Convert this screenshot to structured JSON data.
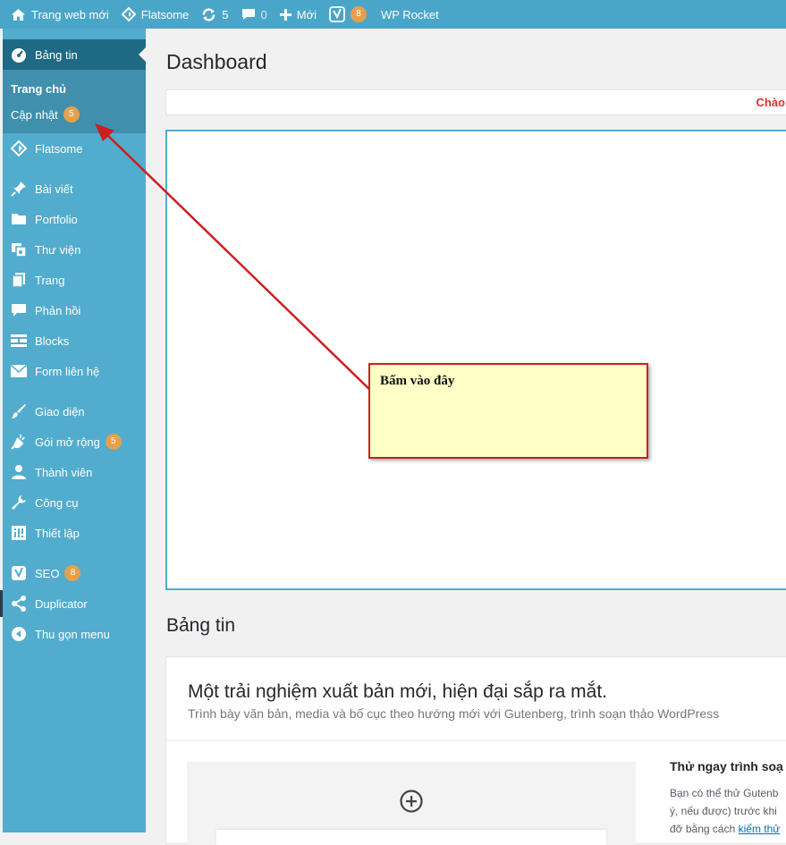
{
  "adminbar": {
    "site_name": "Trang web mới",
    "theme": "Flatsome",
    "updates_count": "5",
    "comments_count": "0",
    "new_label": "Mới",
    "seo_count": "8",
    "rocket_label": "WP Rocket"
  },
  "sidebar": {
    "dashboard": "Bảng tin",
    "sub_home": "Trang chủ",
    "sub_updates": "Cập nhật",
    "sub_updates_badge": "5",
    "items": [
      {
        "label": "Flatsome",
        "icon": "flatsome-icon"
      },
      {
        "label": "Bài viết",
        "icon": "pin-icon"
      },
      {
        "label": "Portfolio",
        "icon": "folder-icon"
      },
      {
        "label": "Thư viện",
        "icon": "media-icon"
      },
      {
        "label": "Trang",
        "icon": "pages-icon"
      },
      {
        "label": "Phản hồi",
        "icon": "comment-icon"
      },
      {
        "label": "Blocks",
        "icon": "blocks-icon"
      },
      {
        "label": "Form liên hệ",
        "icon": "mail-icon"
      },
      {
        "label": "Giao diện",
        "icon": "brush-icon"
      },
      {
        "label": "Gói mở rộng",
        "icon": "plugin-icon",
        "badge": "5"
      },
      {
        "label": "Thành viên",
        "icon": "user-icon"
      },
      {
        "label": "Công cụ",
        "icon": "wrench-icon"
      },
      {
        "label": "Thiết lập",
        "icon": "settings-icon"
      },
      {
        "label": "SEO",
        "icon": "yoast-icon",
        "badge": "8"
      },
      {
        "label": "Duplicator",
        "icon": "share-icon"
      },
      {
        "label": "Thu gọn menu",
        "icon": "collapse-icon"
      }
    ]
  },
  "main": {
    "page_title": "Dashboard",
    "notice_text": "Chào",
    "section_title": "Bảng tin",
    "panel_title": "Một trải nghiệm xuất bản mới, hiện đại sắp ra mắt.",
    "panel_subtitle": "Trình bày văn bản, media và bố cục theo hướng mới với Gutenberg, trình soạn thảo WordPress",
    "try_title": "Thử ngay trình soạ",
    "try_line1": "Bạn có thể thử Gutenb",
    "try_line2": "ý, nếu được) trước khi",
    "try_line3": "đỡ bằng cách",
    "try_link": "kiểm thử"
  },
  "callout": {
    "text": "Bấm vào đây"
  },
  "colors": {
    "sidebar_bg": "#52accd",
    "adminbar_bg": "#4aa6c9",
    "active_bg": "#1e6a85",
    "badge": "#e5a04e",
    "arrow": "#cc1f1f"
  }
}
